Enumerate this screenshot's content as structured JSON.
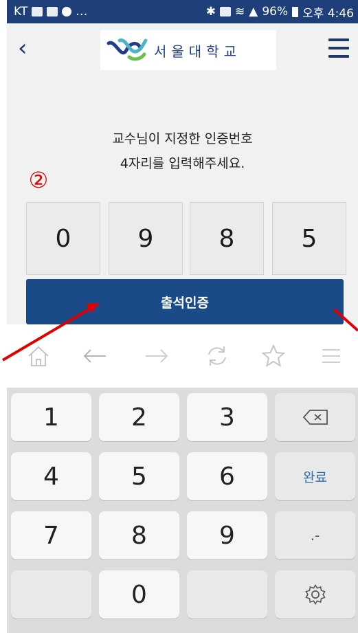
{
  "status_bar": {
    "carrier": "KT",
    "battery": "96%",
    "clock": "오후 4:46"
  },
  "header": {
    "logo_text": "서울대학교",
    "back_icon": "chevron-left-icon",
    "menu_icon": "hamburger-menu-icon"
  },
  "main": {
    "instruction_line1": "교수님이 지정한 인증번호",
    "instruction_line2": "4자리를 입력해주세요.",
    "annotation_number": "②",
    "digits": [
      "0",
      "9",
      "8",
      "5"
    ],
    "confirm_label": "출석인증"
  },
  "browser_nav": {
    "icons": [
      "home-icon",
      "back-arrow-icon",
      "forward-arrow-icon",
      "refresh-icon",
      "star-icon",
      "menu-icon"
    ]
  },
  "keypad": {
    "keys": [
      "1",
      "2",
      "3",
      "4",
      "5",
      "6",
      "7",
      "8",
      "9",
      "0"
    ],
    "done_label": "완료",
    "punct_label": ".-",
    "backspace_icon": "backspace-icon",
    "settings_icon": "gear-icon"
  },
  "colors": {
    "status_bar": "#1e3f7a",
    "confirm_button": "#1b4a88",
    "annotation": "#e00000",
    "done_text": "#2a6fb5"
  }
}
